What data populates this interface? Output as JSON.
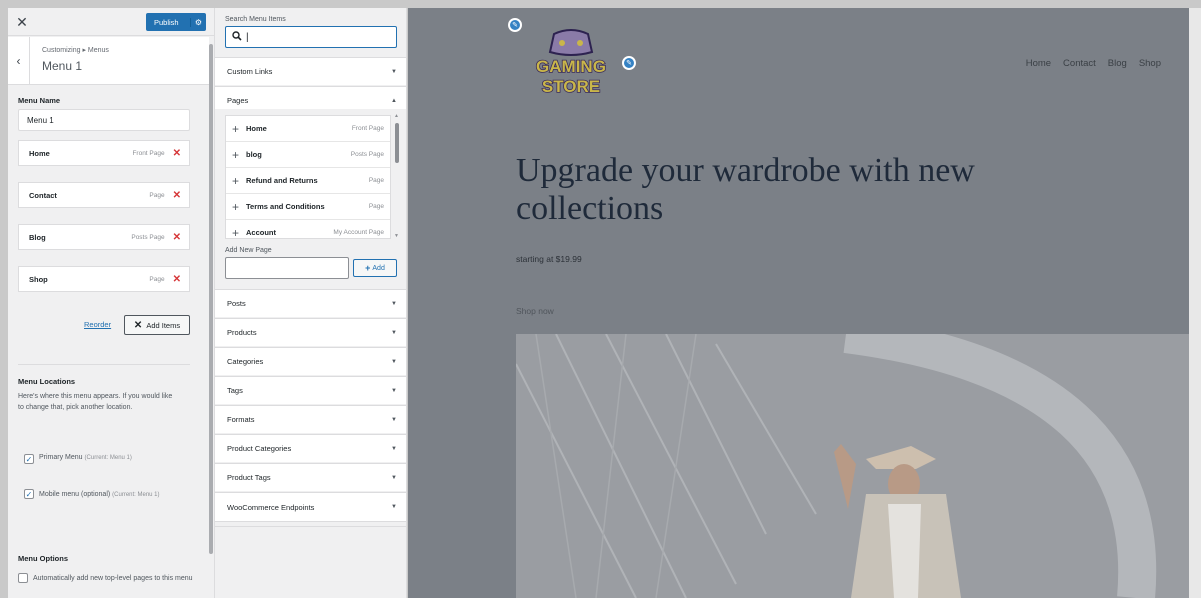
{
  "topbar": {
    "close_glyph": "✕",
    "publish_label": "Publish",
    "publish_gear": "⚙"
  },
  "header": {
    "back_glyph": "‹",
    "breadcrumb": "Customizing ▸ Menus",
    "title": "Menu 1"
  },
  "menu_name": {
    "label": "Menu Name",
    "value": "Menu 1"
  },
  "menu_items": [
    {
      "label": "Home",
      "type": "Front Page"
    },
    {
      "label": "Contact",
      "type": "Page"
    },
    {
      "label": "Blog",
      "type": "Posts Page"
    },
    {
      "label": "Shop",
      "type": "Page"
    }
  ],
  "remove_glyph": "✕",
  "actions": {
    "reorder": "Reorder",
    "add_items": "Add Items",
    "add_items_glyph": "✕"
  },
  "menu_locations": {
    "heading": "Menu Locations",
    "description": "Here's where this menu appears. If you would like to change that, pick another location.",
    "primary": {
      "label": "Primary Menu",
      "note": "(Current: Menu 1)",
      "checked": true
    },
    "mobile": {
      "label": "Mobile menu (optional)",
      "note": "(Current: Menu 1)",
      "checked": true
    }
  },
  "menu_options": {
    "heading": "Menu Options",
    "auto_add": "Automatically add new top-level pages to this menu"
  },
  "search": {
    "label": "Search Menu Items",
    "icon": "search-icon",
    "value": ""
  },
  "accordions": {
    "custom_links": "Custom Links",
    "pages": "Pages",
    "posts": "Posts",
    "products": "Products",
    "categories": "Categories",
    "tags": "Tags",
    "formats": "Formats",
    "product_categories": "Product Categories",
    "product_tags": "Product Tags",
    "woocommerce_endpoints": "WooCommerce Endpoints"
  },
  "chev_down": "▼",
  "chev_up": "▲",
  "pages_list": [
    {
      "label": "Home",
      "type": "Front Page"
    },
    {
      "label": "blog",
      "type": "Posts Page"
    },
    {
      "label": "Refund and Returns",
      "type": "Page"
    },
    {
      "label": "Terms and Conditions",
      "type": "Page"
    },
    {
      "label": "Account",
      "type": "My Account Page"
    }
  ],
  "plus_glyph": "+",
  "add_new_page": {
    "label": "Add New Page",
    "button": "Add"
  },
  "preview": {
    "logo_line1": "GAMING",
    "logo_line2": "STORE",
    "nav": [
      "Home",
      "Contact",
      "Blog",
      "Shop"
    ],
    "hero_title": "Upgrade your wardrobe with new collections",
    "hero_subtitle": "starting at $19.99",
    "hero_cta": "Shop now"
  },
  "colors": {
    "accent": "#2271b1",
    "danger": "#d63638",
    "preview_overlay": "#7b8087"
  }
}
